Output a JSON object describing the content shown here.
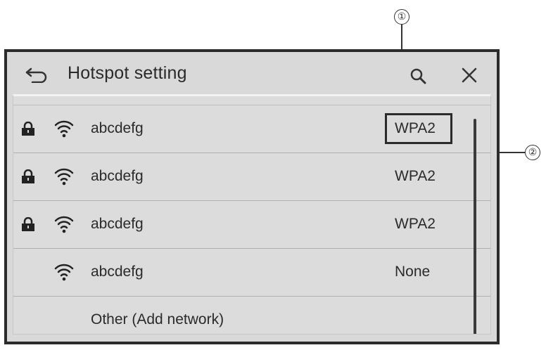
{
  "header": {
    "title": "Hotspot setting",
    "back_icon": "back-arrow-icon",
    "search_icon": "search-icon",
    "close_icon": "close-icon"
  },
  "networks": [
    {
      "name": "abcdefg",
      "security": "WPA2",
      "locked": true,
      "icon": "wifi-icon"
    },
    {
      "name": "abcdefg",
      "security": "WPA2",
      "locked": true,
      "icon": "wifi-icon"
    },
    {
      "name": "abcdefg",
      "security": "WPA2",
      "locked": true,
      "icon": "wifi-icon"
    },
    {
      "name": "abcdefg",
      "security": "None",
      "locked": false,
      "icon": "wifi-icon"
    }
  ],
  "add_network_label": "Other (Add network)",
  "callouts": {
    "one": "①",
    "two": "②"
  },
  "colors": {
    "background": "#d9d9d9",
    "frame": "#2b2b2b",
    "text": "#2a2a2a"
  }
}
